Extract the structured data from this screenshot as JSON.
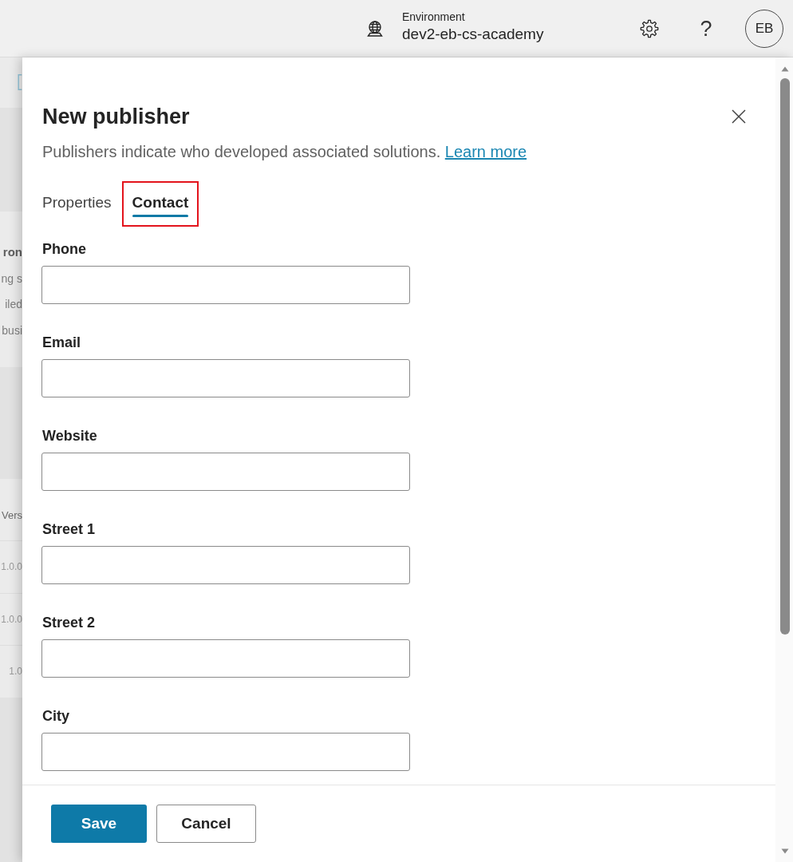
{
  "top_bar": {
    "environment_label": "Environment",
    "environment_name": "dev2-eb-cs-academy",
    "help_button": "?",
    "avatar_initials": "EB"
  },
  "background": {
    "card_lines": [
      {
        "text": "ron",
        "kind": "heading"
      },
      {
        "text": "ng s",
        "kind": "body"
      },
      {
        "text": "iled",
        "kind": "body"
      },
      {
        "text": "busi",
        "kind": "body"
      }
    ],
    "table_rows": [
      {
        "text": "Vers",
        "kind": "header"
      },
      {
        "text": "1.0.0",
        "kind": "cell"
      },
      {
        "text": "1.0.0",
        "kind": "cell"
      },
      {
        "text": "1.0",
        "kind": "cell"
      }
    ]
  },
  "panel": {
    "title": "New publisher",
    "description": "Publishers indicate who developed associated solutions.",
    "learn_more_link": "Learn more",
    "tabs": [
      {
        "label": "Properties",
        "selected": false,
        "highlighted": false
      },
      {
        "label": "Contact",
        "selected": true,
        "highlighted": true
      }
    ],
    "fields": [
      {
        "label": "Phone"
      },
      {
        "label": "Email"
      },
      {
        "label": "Website"
      },
      {
        "label": "Street 1"
      },
      {
        "label": "Street 2"
      },
      {
        "label": "City"
      }
    ],
    "buttons": [
      {
        "label": "Save",
        "kind": "primary"
      },
      {
        "label": "Cancel",
        "kind": "secondary"
      }
    ]
  }
}
